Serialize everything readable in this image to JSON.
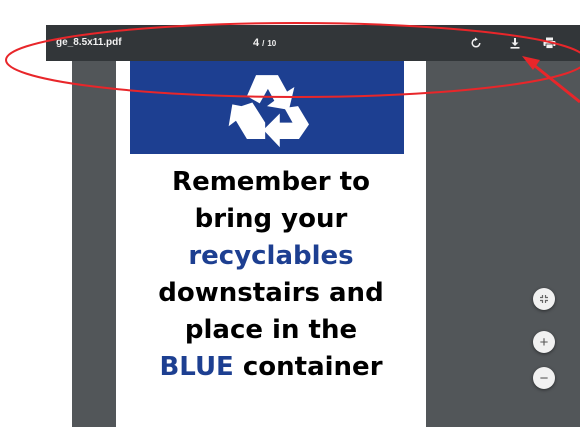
{
  "toolbar": {
    "title": "ge_8.5x11.pdf",
    "current_page": "4",
    "separator": "/",
    "total_pages": "10"
  },
  "document": {
    "line1": "Remember to",
    "line2": "bring your",
    "line3": "recyclables",
    "line4": "downstairs and",
    "line5": "place in the",
    "line6_blue": "BLUE",
    "line6_rest": " container"
  },
  "controls": {
    "zoom_in": "+",
    "zoom_out": "−"
  },
  "icons": {
    "rotate": "rotate-icon",
    "download": "download-icon",
    "print": "print-icon",
    "recycle": "recycle-icon",
    "fit": "fit-to-page-icon"
  },
  "colors": {
    "toolbar": "#323639",
    "viewer_bg": "#525659",
    "brand_blue": "#1d3f91",
    "annotation_red": "#e8262a"
  }
}
